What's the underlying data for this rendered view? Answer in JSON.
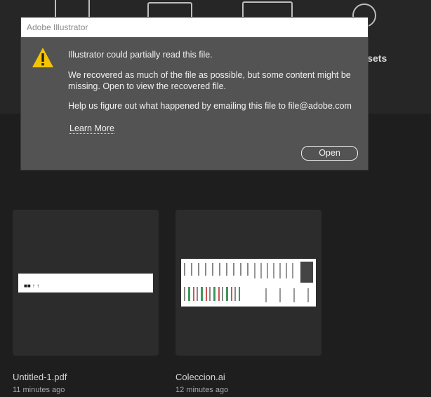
{
  "background": {
    "presets_label": "resets"
  },
  "dialog": {
    "title": "Adobe Illustrator",
    "icon": "warning-icon",
    "heading": "Illustrator could partially read this file.",
    "body": "We recovered as much of the file as possible, but some content might be missing. Open to view the recovered file.",
    "help": "Help us figure out what happened by emailing this file to file@adobe.com",
    "learn_more": "Learn More",
    "open_label": "Open"
  },
  "recent_files": [
    {
      "name": "Untitled-1.pdf",
      "time": "11 minutes ago"
    },
    {
      "name": "Coleccion.ai",
      "time": "12 minutes ago"
    }
  ]
}
